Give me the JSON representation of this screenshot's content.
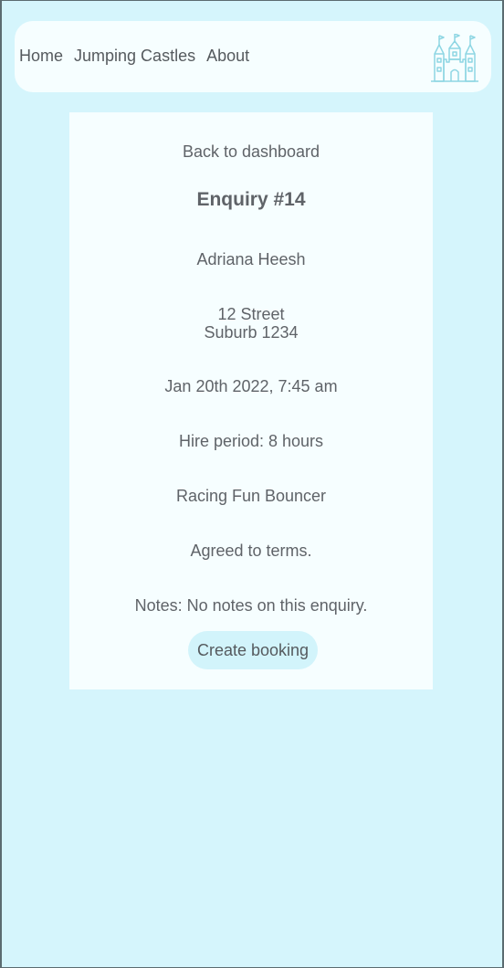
{
  "nav": {
    "links": [
      "Home",
      "Jumping Castles",
      "About"
    ],
    "logo_icon": "castle-icon",
    "logo_color": "#8ed6e3"
  },
  "enquiry": {
    "back_label": "Back to dashboard",
    "title": "Enquiry #14",
    "customer_name": "Adriana Heesh",
    "address_line1": "12 Street",
    "address_line2": "Suburb 1234",
    "datetime": "Jan 20th 2022, 7:45 am",
    "hire_period": "Hire period: 8 hours",
    "product": "Racing Fun Bouncer",
    "terms": "Agreed to terms.",
    "notes": "Notes: No notes on this enquiry.",
    "create_booking_label": "Create booking"
  },
  "colors": {
    "page_background": "#d5f5fc",
    "card_background": "#f6feff",
    "button_background": "#d2f4fb",
    "text": "#5f6368"
  }
}
